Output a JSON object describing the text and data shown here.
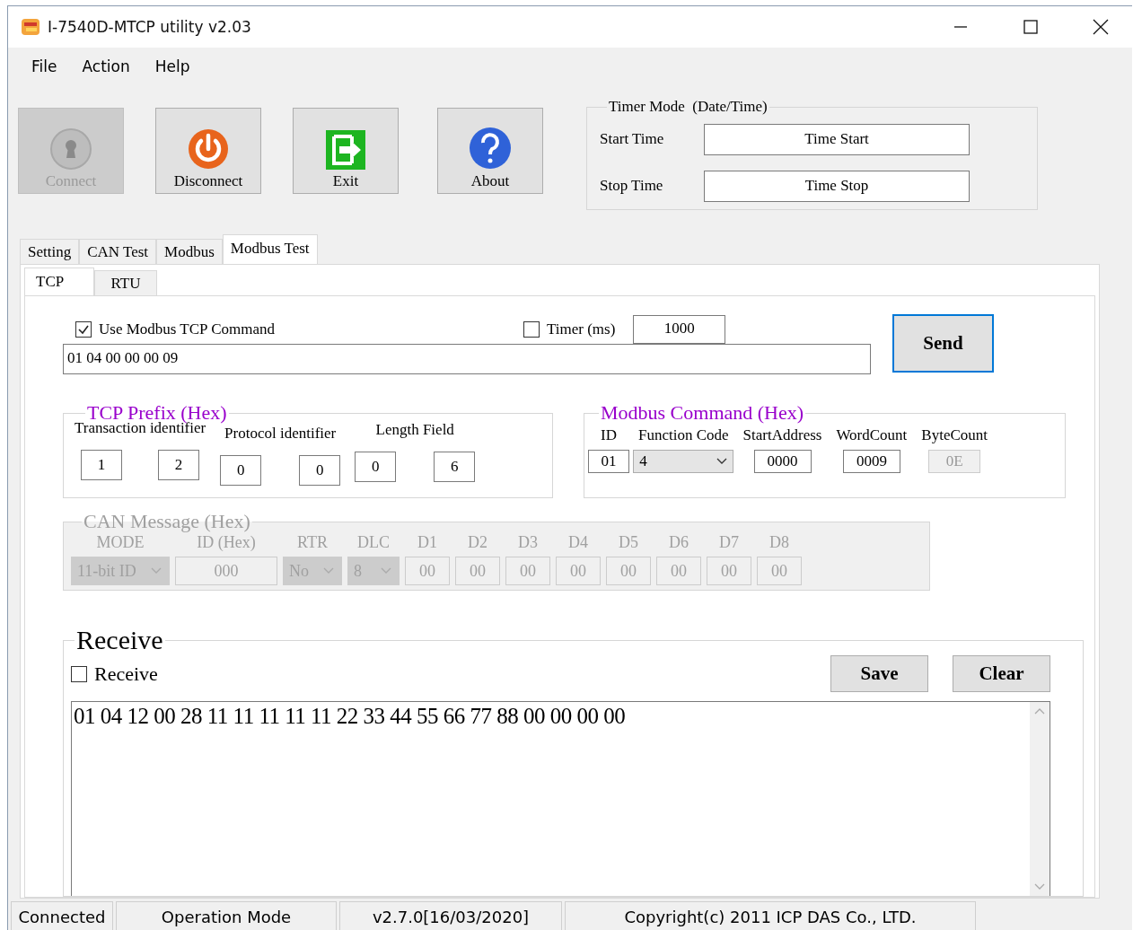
{
  "window": {
    "title": "I-7540D-MTCP utility v2.03"
  },
  "menu": [
    "File",
    "Action",
    "Help"
  ],
  "toolbar": [
    {
      "label": "Connect",
      "kind": "connect",
      "disabled": true
    },
    {
      "label": "Disconnect",
      "kind": "power",
      "disabled": false
    },
    {
      "label": "Exit",
      "kind": "exit",
      "disabled": false
    },
    {
      "label": "About",
      "kind": "help",
      "disabled": false
    }
  ],
  "timer_mode": {
    "title": "Timer Mode  (Date/Time)",
    "rows": [
      {
        "label": "Start Time",
        "button": "Time Start"
      },
      {
        "label": "Stop Time",
        "button": "Time Stop"
      }
    ]
  },
  "tabs": [
    {
      "label": "Setting",
      "selected": false
    },
    {
      "label": "CAN Test",
      "selected": false
    },
    {
      "label": "Modbus",
      "selected": false
    },
    {
      "label": "Modbus Test",
      "selected": true
    }
  ],
  "subtabs": [
    {
      "label": "TCP",
      "selected": true
    },
    {
      "label": "RTU",
      "selected": false
    }
  ],
  "command": {
    "use_tcp": {
      "label": "Use Modbus TCP Command",
      "checked": true
    },
    "timer": {
      "label": "Timer (ms)",
      "checked": false,
      "value": "1000"
    },
    "value": "01 04 00 00 00 09",
    "send": "Send"
  },
  "tcp_prefix": {
    "title": "TCP Prefix (Hex)",
    "groups": [
      {
        "label": "Transaction identifier",
        "values": [
          "1",
          "2"
        ]
      },
      {
        "label": "Protocol identifier",
        "values": [
          "0",
          "0"
        ]
      },
      {
        "label": "Length Field",
        "values": [
          "0",
          "6"
        ]
      }
    ]
  },
  "modbus_command": {
    "title": "Modbus Command (Hex)",
    "fields": [
      {
        "label": "ID",
        "value": "01",
        "kind": "text",
        "disabled": false
      },
      {
        "label": "Function Code",
        "value": "4",
        "kind": "select",
        "disabled": false
      },
      {
        "label": "StartAddress",
        "value": "0000",
        "kind": "text",
        "disabled": false
      },
      {
        "label": "WordCount",
        "value": "0009",
        "kind": "text",
        "disabled": false
      },
      {
        "label": "ByteCount",
        "value": "0E",
        "kind": "text",
        "disabled": true
      }
    ]
  },
  "can_message": {
    "title": "CAN Message (Hex)",
    "disabled": true,
    "fields": [
      {
        "label": "MODE",
        "value": "11-bit ID",
        "kind": "select"
      },
      {
        "label": "ID (Hex)",
        "value": "000",
        "kind": "text"
      },
      {
        "label": "RTR",
        "value": "No",
        "kind": "select"
      },
      {
        "label": "DLC",
        "value": "8",
        "kind": "select"
      },
      {
        "label": "D1",
        "value": "00",
        "kind": "text"
      },
      {
        "label": "D2",
        "value": "00",
        "kind": "text"
      },
      {
        "label": "D3",
        "value": "00",
        "kind": "text"
      },
      {
        "label": "D4",
        "value": "00",
        "kind": "text"
      },
      {
        "label": "D5",
        "value": "00",
        "kind": "text"
      },
      {
        "label": "D6",
        "value": "00",
        "kind": "text"
      },
      {
        "label": "D7",
        "value": "00",
        "kind": "text"
      },
      {
        "label": "D8",
        "value": "00",
        "kind": "text"
      }
    ]
  },
  "receive": {
    "title": "Receive",
    "checkbox": {
      "label": "Receive",
      "checked": false
    },
    "buttons": [
      "Save",
      "Clear"
    ],
    "output": "01 04 12 00 28 11 11 11 11 11 22 33 44 55 66 77 88 00 00 00 00"
  },
  "status_bar": [
    "Connected",
    "Operation Mode",
    "v2.7.0[16/03/2020]",
    "Copyright(c) 2011 ICP DAS Co., LTD."
  ]
}
